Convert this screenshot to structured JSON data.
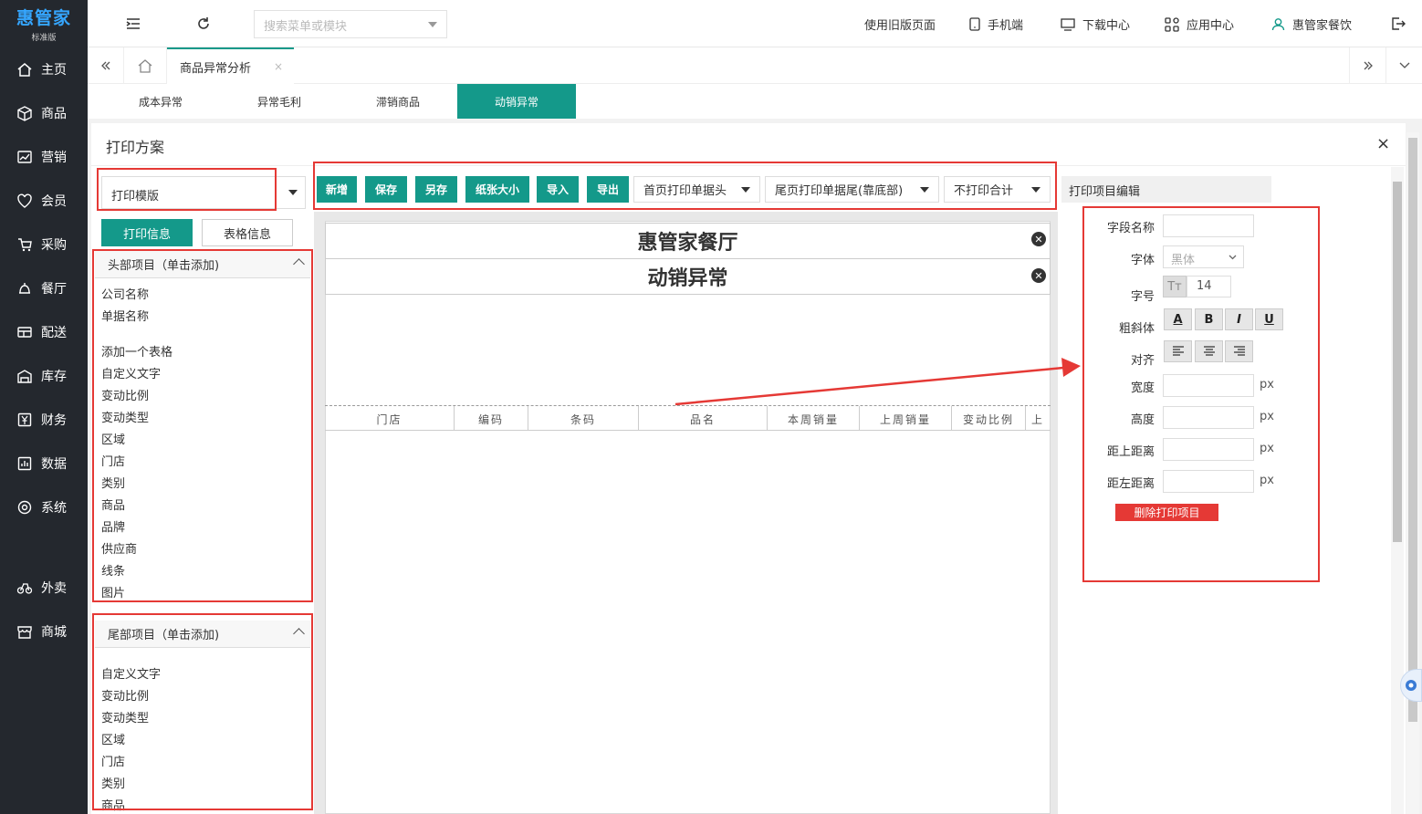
{
  "app": {
    "logo": "惠管家",
    "edition": "标准版"
  },
  "sidebar": {
    "items": [
      {
        "label": "主页",
        "icon": "home-icon"
      },
      {
        "label": "商品",
        "icon": "box-icon"
      },
      {
        "label": "营销",
        "icon": "chart-icon"
      },
      {
        "label": "会员",
        "icon": "heart-icon"
      },
      {
        "label": "采购",
        "icon": "cart-icon"
      },
      {
        "label": "餐厅",
        "icon": "bell-icon"
      },
      {
        "label": "配送",
        "icon": "truck-icon"
      },
      {
        "label": "库存",
        "icon": "warehouse-icon"
      },
      {
        "label": "财务",
        "icon": "yen-icon"
      },
      {
        "label": "数据",
        "icon": "data-icon"
      },
      {
        "label": "系统",
        "icon": "gear-icon"
      },
      {
        "label": "外卖",
        "icon": "bike-icon"
      },
      {
        "label": "商城",
        "icon": "store-icon"
      }
    ]
  },
  "topbar": {
    "search_placeholder": "搜索菜单或模块",
    "old_page": "使用旧版页面",
    "mobile": "手机端",
    "download": "下载中心",
    "apps": "应用中心",
    "user": "惠管家餐饮"
  },
  "tabs": {
    "active": "商品异常分析",
    "close": "×"
  },
  "subtabs": [
    {
      "label": "成本异常",
      "active": false
    },
    {
      "label": "异常毛利",
      "active": false
    },
    {
      "label": "滞销商品",
      "active": false
    },
    {
      "label": "动销异常",
      "active": true
    }
  ],
  "modal": {
    "title": "打印方案",
    "close": "×",
    "template_select": "打印模版",
    "info_tab": "打印信息",
    "table_tab": "表格信息",
    "header_panel": {
      "title": "头部项目（单击添加)",
      "items": [
        "公司名称",
        "单据名称",
        "添加一个表格",
        "自定义文字",
        "变动比例",
        "变动类型",
        "区域",
        "门店",
        "类别",
        "商品",
        "品牌",
        "供应商",
        "线条",
        "图片"
      ]
    },
    "footer_panel": {
      "title": "尾部项目（单击添加)",
      "items": [
        "自定义文字",
        "变动比例",
        "变动类型",
        "区域",
        "门店",
        "类别",
        "商品"
      ]
    },
    "toolbar": {
      "buttons": [
        "新增",
        "保存",
        "另存",
        "纸张大小",
        "导入",
        "导出"
      ],
      "dropdowns": [
        "首页打印单据头",
        "尾页打印单据尾(靠底部)",
        "不打印合计"
      ]
    },
    "paper": {
      "company": "惠管家餐厅",
      "doc_name": "动销异常",
      "columns": [
        "门店",
        "编码",
        "条码",
        "品名",
        "本周销量",
        "上周销量",
        "变动比例",
        "上"
      ]
    },
    "editor": {
      "title": "打印项目编辑",
      "field_name": "字段名称",
      "font": "字体",
      "font_value": "黑体",
      "size": "字号",
      "size_value": "14",
      "style": "粗斜体",
      "align": "对齐",
      "width": "宽度",
      "height": "高度",
      "top": "距上距离",
      "left": "距左距离",
      "unit": "px",
      "bold": "B",
      "italic": "I",
      "underline": "U",
      "font_letter": "A",
      "delete": "删除打印项目"
    }
  },
  "colors": {
    "accent": "#14998a",
    "sidebar": "#24282e",
    "danger": "#e53935",
    "annotation": "#e53935"
  }
}
